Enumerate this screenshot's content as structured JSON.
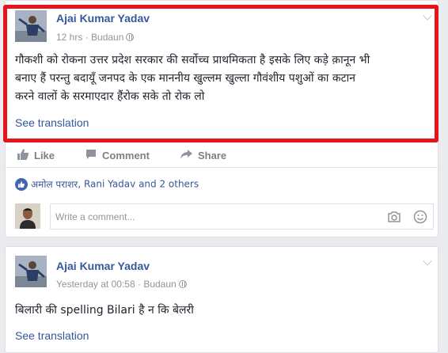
{
  "posts": [
    {
      "author": "Ajai Kumar Yadav",
      "time": "12 hrs",
      "separator": " · ",
      "location": "Budaun",
      "text_line1": "गौकशी को रोकना उत्तर प्रदेश सरकार की सर्वोच्च प्राथमिकता है इसके लिए कड़े क़ानून भी",
      "text_line2": "बनाए हैं परन्तु बदायूँ जनपद के एक माननीय खुल्लम खुल्ला गौवंशीय पशुओं का कटान",
      "text_line3": "करने वालों के सरमाएदार हैंरोक सके तो रोक लो",
      "see_translation": "See translation"
    },
    {
      "author": "Ajai Kumar Yadav",
      "time": "Yesterday at 00:58",
      "separator": " · ",
      "location": "Budaun",
      "text_line1": "बिलारी की spelling Bilari है न कि बेलरी",
      "see_translation": "See translation"
    }
  ],
  "actions": {
    "like": "Like",
    "comment": "Comment",
    "share": "Share"
  },
  "reactions": {
    "name1": "अमोल पराशर",
    "comma": ", ",
    "name2": "Rani Yadav",
    "others": " and 2 others"
  },
  "comment_box": {
    "placeholder": "Write a comment..."
  },
  "colors": {
    "link": "#365899",
    "highlight_border": "#e8141b",
    "like_badge": "#4267b2",
    "page_bg": "#e9ebee"
  },
  "icons": [
    "like-icon",
    "comment-icon",
    "share-icon",
    "camera-icon",
    "emoji-icon",
    "globe-icon",
    "chevron-down-icon"
  ]
}
